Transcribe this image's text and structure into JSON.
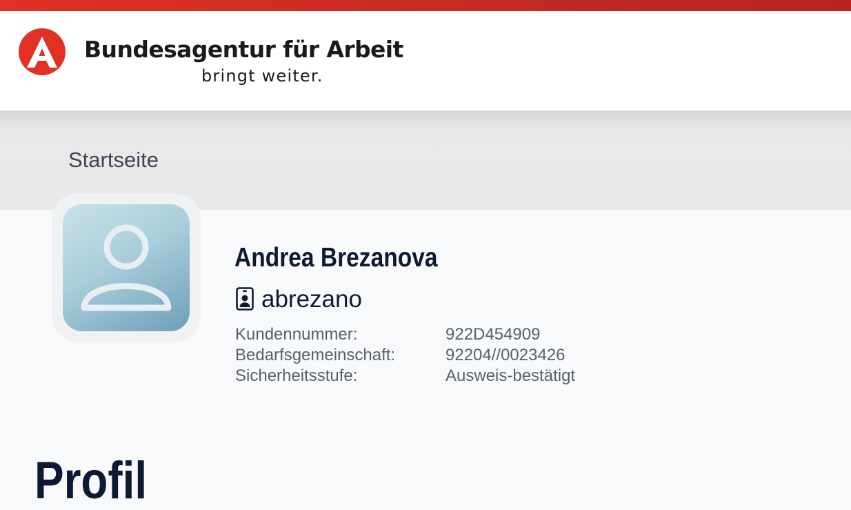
{
  "header": {
    "brand_name": "Bundesagentur für Arbeit",
    "slogan": "bringt weiter.",
    "logo_icon": "ba-logo-icon",
    "accent_color": "#e03124"
  },
  "breadcrumb": {
    "home_label": "Startseite"
  },
  "profile": {
    "avatar_icon": "user-avatar-icon",
    "name": "Andrea Brezanova",
    "login_icon": "id-badge-icon",
    "login": "abrezano",
    "details": [
      {
        "label": "Kundennummer:",
        "value": "922D454909"
      },
      {
        "label": "Bedarfsgemeinschaft:",
        "value": "92204//0023426"
      },
      {
        "label": "Sicherheitsstufe:",
        "value": "Ausweis-bestätigt"
      }
    ]
  },
  "page": {
    "heading": "Profil"
  }
}
